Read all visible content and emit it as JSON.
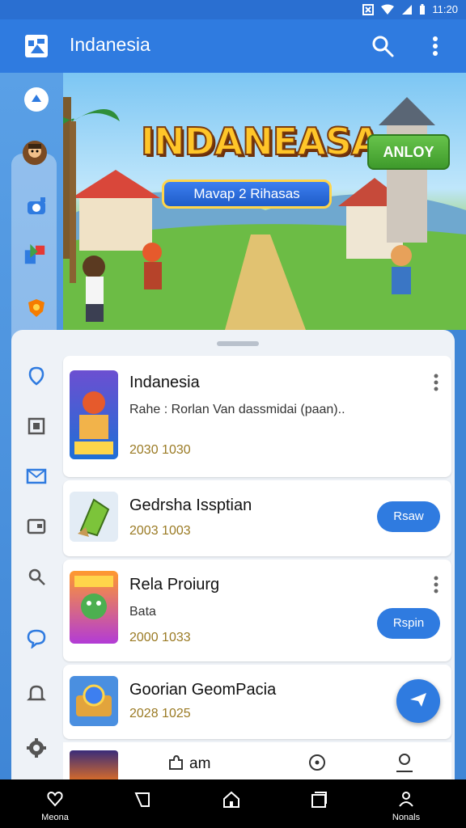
{
  "status": {
    "time": "11:20"
  },
  "appbar": {
    "title": "Indanesia",
    "icons": [
      "app-logo-icon",
      "search-icon",
      "more-vert-icon"
    ]
  },
  "banner": {
    "title": "INDANEASA",
    "subtitle": "Mavap 2 Rihasas",
    "button": "ANLOY"
  },
  "apps": [
    {
      "name": "Indanesia",
      "description": "Rahe : Rorlan Van dassmidai (paan)..",
      "date": "2030 1030"
    },
    {
      "name": "Gedrsha Issptian",
      "date": "2003 1003",
      "action": "Rsaw"
    },
    {
      "name": "Rela Proiurg",
      "description": "Bata",
      "date": "2000 1033",
      "action": "Rspin"
    },
    {
      "name": "Goorian GeomPacia",
      "date": "2028 1025"
    }
  ],
  "bottom_tabs": {
    "label": "am"
  },
  "nav": {
    "left_label": "Meona",
    "right_label": "Nonals"
  },
  "colors": {
    "primary": "#2f7be0",
    "accent_gold": "#ffc629",
    "date_text": "#9a7a23"
  }
}
